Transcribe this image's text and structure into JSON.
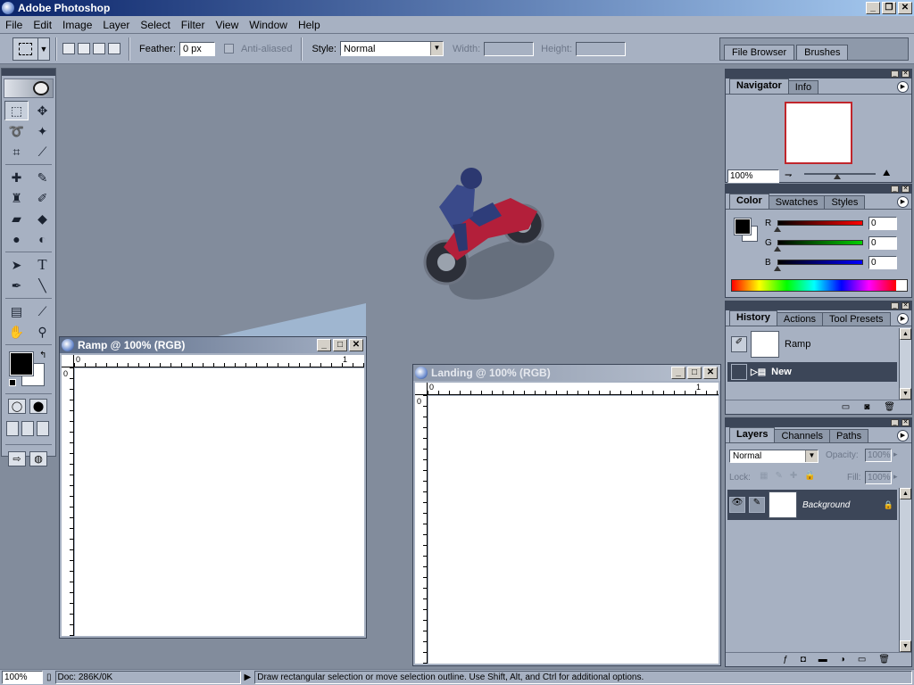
{
  "app": {
    "title": "Adobe Photoshop"
  },
  "menu": [
    "File",
    "Edit",
    "Image",
    "Layer",
    "Select",
    "Filter",
    "View",
    "Window",
    "Help"
  ],
  "options": {
    "feather_label": "Feather:",
    "feather_value": "0 px",
    "antialiased_label": "Anti-aliased",
    "style_label": "Style:",
    "style_value": "Normal",
    "width_label": "Width:",
    "height_label": "Height:",
    "file_browser_tab": "File Browser",
    "brushes_tab": "Brushes"
  },
  "documents": {
    "ramp": {
      "title": "Ramp @ 100% (RGB)",
      "ruler_zero": "0",
      "ruler_one": "1",
      "vruler_zero": "0"
    },
    "landing": {
      "title": "Landing @ 100% (RGB)",
      "ruler_zero": "0",
      "ruler_one": "1",
      "vruler_zero": "0"
    }
  },
  "navigator": {
    "tab_navigator": "Navigator",
    "tab_info": "Info",
    "zoom": "100%"
  },
  "color": {
    "tab_color": "Color",
    "tab_swatches": "Swatches",
    "tab_styles": "Styles",
    "r_label": "R",
    "g_label": "G",
    "b_label": "B",
    "r_value": "0",
    "g_value": "0",
    "b_value": "0"
  },
  "history": {
    "tab_history": "History",
    "tab_actions": "Actions",
    "tab_presets": "Tool Presets",
    "snapshot_label": "Ramp",
    "state_label": "New"
  },
  "layers": {
    "tab_layers": "Layers",
    "tab_channels": "Channels",
    "tab_paths": "Paths",
    "blend_mode": "Normal",
    "opacity_label": "Opacity:",
    "opacity_value": "100%",
    "lock_label": "Lock:",
    "fill_label": "Fill:",
    "fill_value": "100%",
    "layer_name": "Background"
  },
  "status": {
    "zoom": "100%",
    "doc": "Doc: 286K/0K",
    "hint": "Draw rectangular selection or move selection outline.  Use Shift, Alt, and Ctrl for additional options."
  },
  "colors": {
    "titlebar": "#0a246a",
    "panel": "#a7b1c2",
    "workspace": "#828c9c"
  }
}
